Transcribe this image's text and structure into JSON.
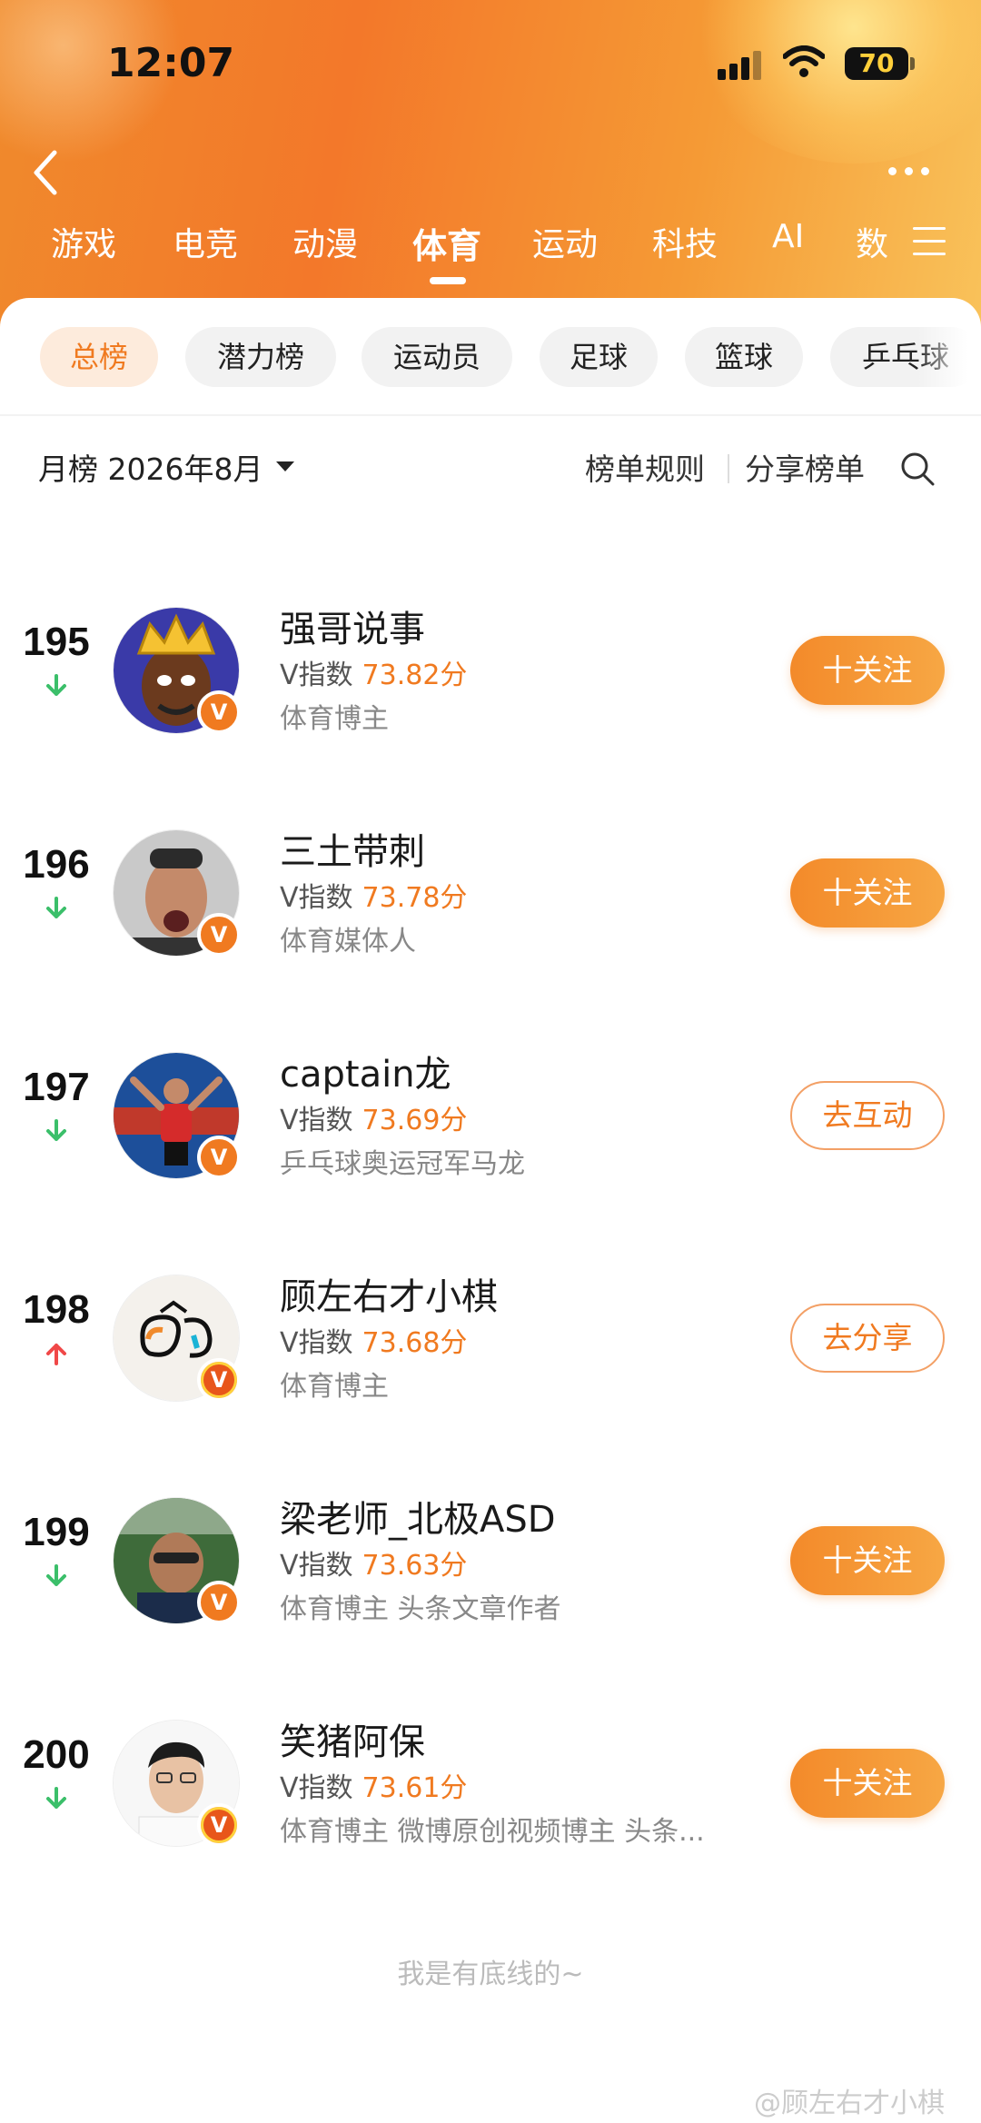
{
  "status": {
    "time": "12:07",
    "battery": "70"
  },
  "categories": [
    {
      "label": "游戏",
      "active": false
    },
    {
      "label": "电竞",
      "active": false
    },
    {
      "label": "动漫",
      "active": false
    },
    {
      "label": "体育",
      "active": true
    },
    {
      "label": "运动",
      "active": false
    },
    {
      "label": "科技",
      "active": false
    },
    {
      "label": "AI",
      "active": false
    },
    {
      "label": "数",
      "active": false
    }
  ],
  "chips": [
    {
      "label": "总榜",
      "active": true
    },
    {
      "label": "潜力榜",
      "active": false
    },
    {
      "label": "运动员",
      "active": false
    },
    {
      "label": "足球",
      "active": false
    },
    {
      "label": "篮球",
      "active": false
    },
    {
      "label": "乒乓球",
      "active": false
    }
  ],
  "toolbar": {
    "period": "月榜 2026年8月",
    "rules": "榜单规则",
    "share": "分享榜单"
  },
  "entries": [
    {
      "rank": "195",
      "trend": "down",
      "name": "强哥说事",
      "vlabel": "V指数",
      "score": "73.82分",
      "desc": "体育博主",
      "button": "十关注",
      "button_type": "follow"
    },
    {
      "rank": "196",
      "trend": "down",
      "name": "三土带刺",
      "vlabel": "V指数",
      "score": "73.78分",
      "desc": "体育媒体人",
      "button": "十关注",
      "button_type": "follow"
    },
    {
      "rank": "197",
      "trend": "down",
      "name": "captain龙",
      "vlabel": "V指数",
      "score": "73.69分",
      "desc": "乒乓球奥运冠军马龙",
      "button": "去互动",
      "button_type": "outline"
    },
    {
      "rank": "198",
      "trend": "up",
      "name": "顾左右才小棋",
      "vlabel": "V指数",
      "score": "73.68分",
      "desc": "体育博主",
      "button": "去分享",
      "button_type": "outline"
    },
    {
      "rank": "199",
      "trend": "down",
      "name": "梁老师_北极ASD",
      "vlabel": "V指数",
      "score": "73.63分",
      "desc": "体育博主 头条文章作者",
      "button": "十关注",
      "button_type": "follow"
    },
    {
      "rank": "200",
      "trend": "down",
      "name": "笑猪阿保",
      "vlabel": "V指数",
      "score": "73.61分",
      "desc": "体育博主 微博原创视频博主 头条...",
      "button": "十关注",
      "button_type": "follow"
    }
  ],
  "footer": {
    "note": "我是有底线的~",
    "watermark": "@顾左右才小棋"
  },
  "colors": {
    "accent": "#f07a20",
    "trend_down": "#3bbf6a",
    "trend_up": "#f04848"
  }
}
